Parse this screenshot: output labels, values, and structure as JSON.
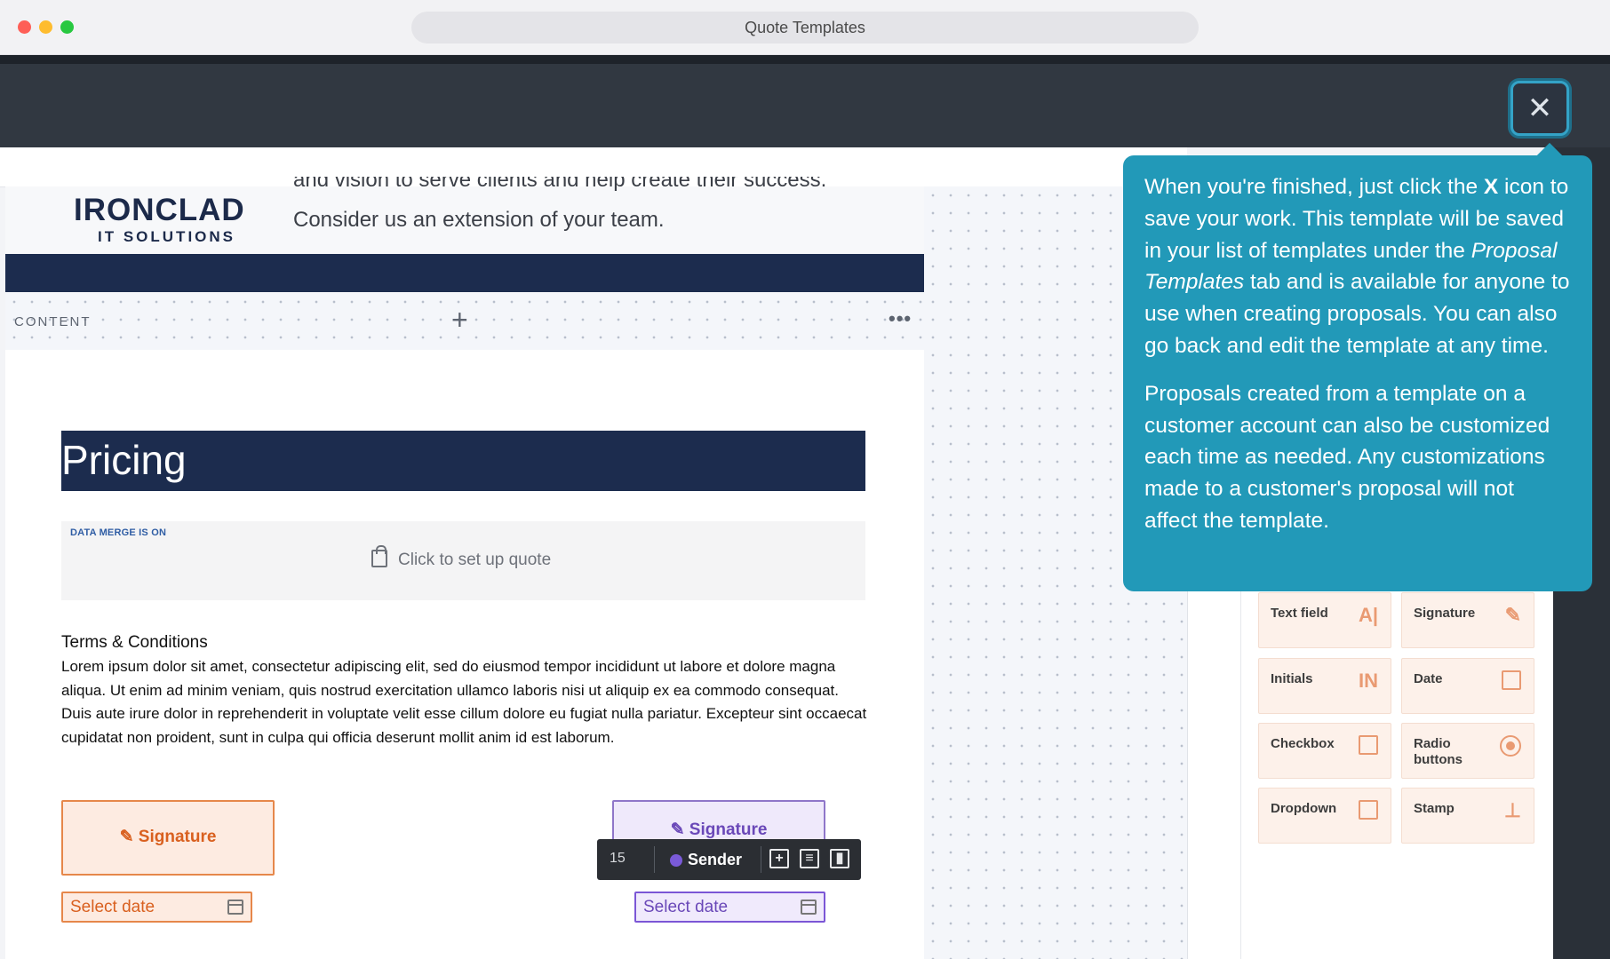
{
  "window": {
    "title": "Quote Templates"
  },
  "close_button": {
    "glyph": "✕"
  },
  "document": {
    "logo_main": "IRONCLAD",
    "logo_sub": "IT SOLUTIONS",
    "header_line1": "and vision to serve clients and help create their success.",
    "header_line2": "Consider us an extension of your team.",
    "content_label": "CONTENT",
    "content_add": "+",
    "content_more": "•••",
    "pricing_title": "Pricing",
    "data_merge_label": "DATA MERGE IS ON",
    "quote_cta": "Click to set up quote",
    "terms_title": "Terms & Conditions",
    "terms_body": "Lorem ipsum dolor sit amet, consectetur adipiscing elit, sed do eiusmod tempor incididunt ut labore et dolore magna aliqua. Ut enim ad minim veniam, quis nostrud exercitation ullamco laboris nisi ut aliquip ex ea commodo consequat. Duis aute irure dolor in reprehenderit in voluptate velit esse cillum dolore eu fugiat nulla pariatur. Excepteur sint occaecat cupidatat non proident, sunt in culpa qui officia deserunt mollit anim id est laborum.",
    "signature_left": "Signature",
    "signature_right": "Signature",
    "date_left_placeholder": "Select date",
    "date_right_placeholder": "Select date"
  },
  "field_toolbar": {
    "size": "15",
    "role": "Sender",
    "role_color": "#7a5ad8"
  },
  "tooltip": {
    "p1_before": "When you're finished, just click the ",
    "p1_bold": "X",
    "p1_mid": " icon to save your work. This template will be saved in your list of templates under the ",
    "p1_italic": "Proposal Templates",
    "p1_after": " tab and is available for anyone to use when creating proposals. You can also go back and edit the template at any time.",
    "p2": "Proposals created from a template on a customer account can also be customized each time as needed. Any customizations made to a customer's proposal will not affect the template."
  },
  "fields_panel": {
    "items": [
      {
        "label": "Text field",
        "icon": "text-field-icon",
        "glyph": "A|"
      },
      {
        "label": "Signature",
        "icon": "pen-icon",
        "glyph": "✎"
      },
      {
        "label": "Initials",
        "icon": "initials-icon",
        "glyph": "IN"
      },
      {
        "label": "Date",
        "icon": "calendar-icon",
        "glyph": ""
      },
      {
        "label": "Checkbox",
        "icon": "checkbox-icon",
        "glyph": "✓"
      },
      {
        "label": "Radio buttons",
        "icon": "radio-icon",
        "glyph": ""
      },
      {
        "label": "Dropdown",
        "icon": "dropdown-icon",
        "glyph": "▾"
      },
      {
        "label": "Stamp",
        "icon": "stamp-icon",
        "glyph": "⊥"
      }
    ]
  },
  "colors": {
    "navy": "#1c2c4e",
    "tooltip": "#2299b8",
    "sender_orange": "#e6874a",
    "recipient_purple": "#7b56d6"
  }
}
